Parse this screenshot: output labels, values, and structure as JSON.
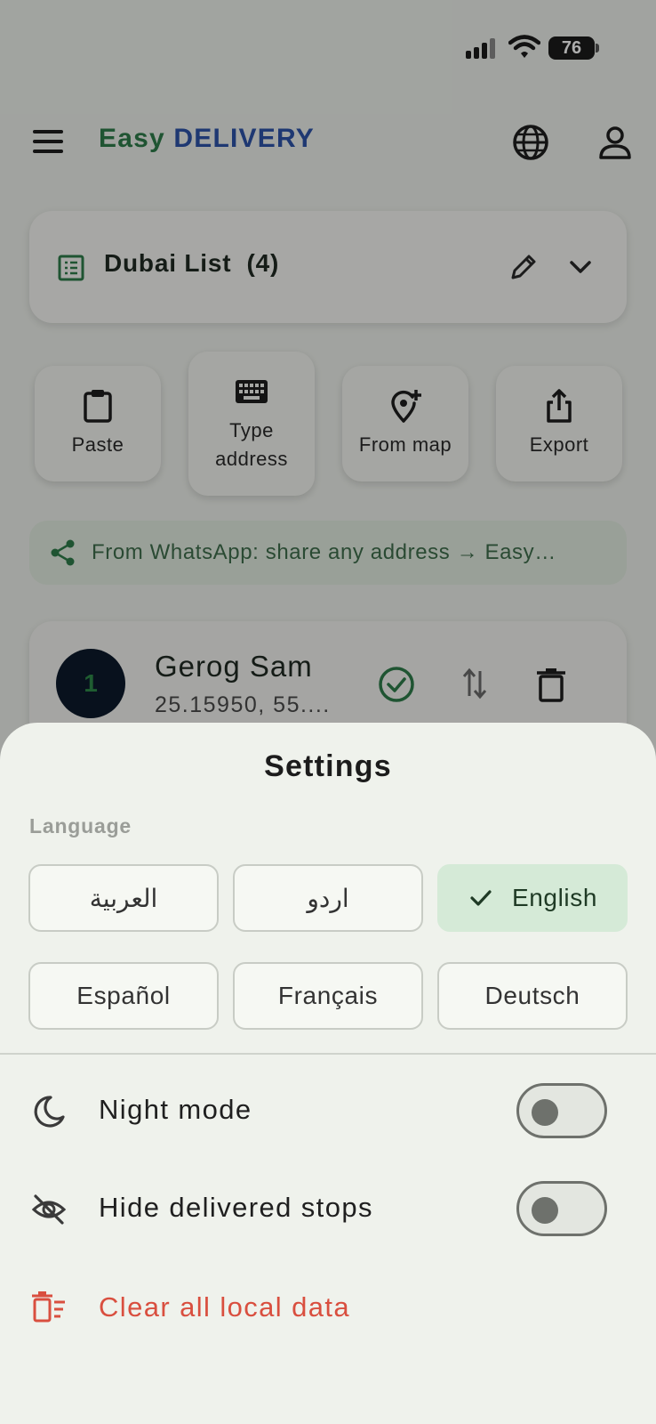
{
  "status_bar": {
    "battery": "76",
    "signal_icon": "cellular-signal-icon",
    "wifi_icon": "wifi-icon"
  },
  "app_bar": {
    "brand_part1": "Easy",
    "brand_part2": "DELIVERY",
    "menu_icon": "hamburger-menu-icon",
    "globe_icon": "globe-icon",
    "user_icon": "user-icon",
    "brand_colors": {
      "easy": "#2e7d4b",
      "delivery": "#2d53a8"
    }
  },
  "list_card": {
    "title": "Dubai List",
    "count": "(4)",
    "list_icon": "list-icon",
    "edit_icon": "pencil-icon",
    "expand_icon": "chevron-down-icon"
  },
  "actions": [
    {
      "label": "Paste",
      "icon": "clipboard-icon"
    },
    {
      "label": "Type address",
      "line1": "Type",
      "line2": "address",
      "icon": "keyboard-icon"
    },
    {
      "label": "From map",
      "icon": "add-location-icon"
    },
    {
      "label": "Export",
      "icon": "share-upload-icon"
    }
  ],
  "whatsapp_hint": {
    "text": "From WhatsApp: share any address → Easy…",
    "icon": "share-icon"
  },
  "stop": {
    "number": "1",
    "name": "Gerog Sam",
    "coords": "25.15950, 55....",
    "check_icon": "check-circle-icon",
    "reorder_icon": "swap-vertical-icon",
    "delete_icon": "trash-icon"
  },
  "settings": {
    "title": "Settings",
    "language_label": "Language",
    "languages": [
      {
        "label": "العربية",
        "selected": false
      },
      {
        "label": "اردو",
        "selected": false
      },
      {
        "label": "English",
        "selected": true
      },
      {
        "label": "Español",
        "selected": false
      },
      {
        "label": "Français",
        "selected": false
      },
      {
        "label": "Deutsch",
        "selected": false
      }
    ],
    "night_mode": {
      "label": "Night mode",
      "enabled": false,
      "icon": "moon-icon"
    },
    "hide_delivered": {
      "label": "Hide delivered stops",
      "enabled": false,
      "icon": "eye-off-icon"
    },
    "clear_data": {
      "label": "Clear all local data",
      "icon": "delete-sweep-icon",
      "color": "#d94f3f"
    },
    "selected_color": "#d5ead7"
  }
}
